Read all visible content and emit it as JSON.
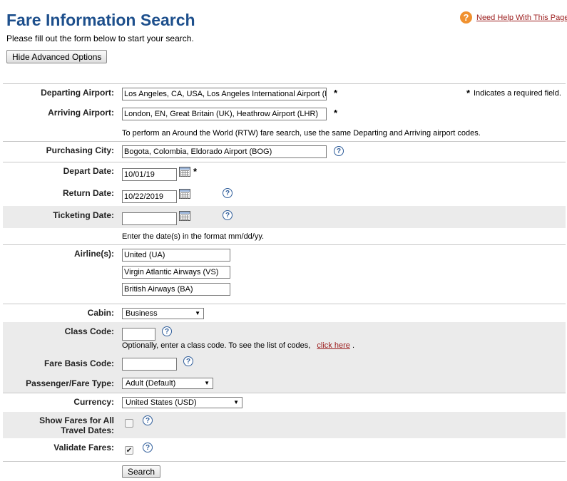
{
  "header": {
    "title": "Fare Information Search",
    "subtitle": "Please fill out the form below to start your search.",
    "help_badge": "?",
    "help_link": "Need Help With This Page?",
    "toggle_button": "Hide Advanced Options"
  },
  "required_marker": "*",
  "required_note": "Indicates a required field.",
  "help_glyph": "?",
  "dropdown_arrow": "▼",
  "check_glyph": "✔",
  "fields": {
    "departing": {
      "label": "Departing Airport:",
      "value": "Los Angeles, CA, USA, Los Angeles International Airport (LAX)"
    },
    "arriving": {
      "label": "Arriving Airport:",
      "value": "London, EN, Great Britain (UK), Heathrow Airport (LHR)"
    },
    "rtw_note": "To perform an Around the World (RTW) fare search, use the same Departing and Arriving airport codes.",
    "purchasing": {
      "label": "Purchasing City:",
      "value": "Bogota, Colombia, Eldorado Airport (BOG)"
    },
    "depart_date": {
      "label": "Depart Date:",
      "value": "10/01/19"
    },
    "return_date": {
      "label": "Return Date:",
      "value": "10/22/2019"
    },
    "ticketing_date": {
      "label": "Ticketing Date:",
      "value": ""
    },
    "date_note": "Enter the date(s) in the format mm/dd/yy.",
    "airlines": {
      "label": "Airline(s):",
      "values": [
        "United (UA)",
        "Virgin Atlantic Airways (VS)",
        "British Airways (BA)"
      ]
    },
    "cabin": {
      "label": "Cabin:",
      "value": "Business"
    },
    "class_code": {
      "label": "Class Code:",
      "value": "",
      "note": "Optionally, enter a class code. To see the list of codes,",
      "link": "click here",
      "tail": "."
    },
    "fare_basis": {
      "label": "Fare Basis Code:",
      "value": ""
    },
    "passenger_type": {
      "label": "Passenger/Fare Type:",
      "value": "Adult (Default)"
    },
    "currency": {
      "label": "Currency:",
      "value": "United States (USD)"
    },
    "show_fares": {
      "label_line1": "Show Fares for All",
      "label_line2": "Travel Dates:",
      "checked": false
    },
    "validate": {
      "label": "Validate Fares:",
      "checked": true
    }
  },
  "search_button": "Search"
}
